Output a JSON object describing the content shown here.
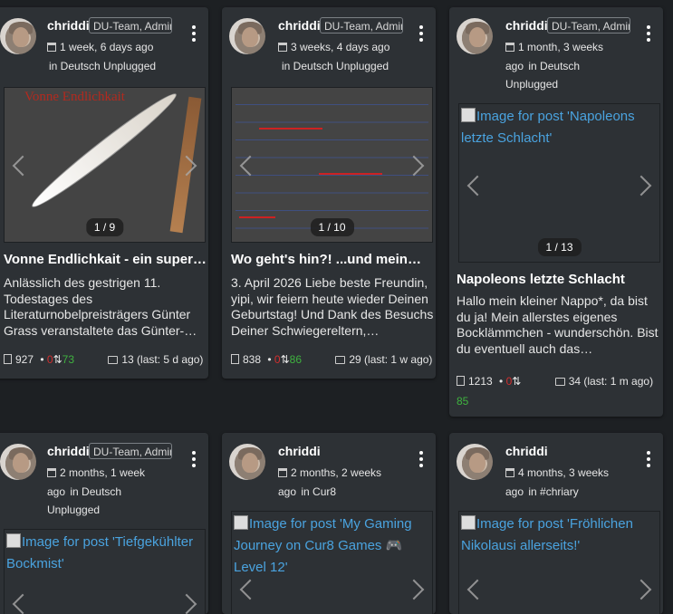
{
  "cards": [
    {
      "author": "chriddi",
      "badge": "DU-Team, Admin",
      "time": "1 week, 6 days ago",
      "community": "in Deutsch Unplugged",
      "counter": "1 / 9",
      "image_text": "Vonne Endlichkait",
      "title": "Vonne Endlichkait - ein super…",
      "excerpt": "Anlässlich des gestrigen 11. Todestages des Literaturnobelpreisträgers Günter Grass veranstaltete das Günter-…",
      "views": "927",
      "down": "0",
      "up": "73",
      "comments": "13 (last: 5 d ago)"
    },
    {
      "author": "chriddi",
      "badge": "DU-Team, Admin",
      "time": "3 weeks, 4 days ago",
      "community": "in Deutsch Unplugged",
      "counter": "1 / 10",
      "title": "Wo geht's hin?! ...und mein…",
      "excerpt": "3. April 2026 Liebe beste Freundin, yipi, wir feiern heute wieder Deinen Geburtstag! Und Dank des Besuchs Deiner Schwiegereltern,…",
      "views": "838",
      "down": "0",
      "up": "86",
      "comments": "29 (last: 1 w ago)"
    },
    {
      "author": "chriddi",
      "badge": "DU-Team, Admin",
      "time": "1 month, 3 weeks ago",
      "community": "in Deutsch Unplugged",
      "counter": "1 / 13",
      "broken_image": "Image for post 'Napoleons letzte Schlacht'",
      "title": "Napoleons letzte Schlacht",
      "excerpt": "Hallo mein kleiner Nappo*, da bist du ja! Mein allerstes eigenes Bocklämmchen - wunderschön. Bist du eventuell auch das…",
      "views": "1213",
      "down": "0",
      "up": "85",
      "comments": "34 (last: 1 m ago)"
    },
    {
      "author": "chriddi",
      "badge": "DU-Team, Admin",
      "time": "2 months, 1 week ago",
      "community": "in Deutsch Unplugged",
      "broken_image": "Image for post 'Tiefgekühlter Bockmist'"
    },
    {
      "author": "chriddi",
      "time": "2 months, 2 weeks ago",
      "community": "in Cur8",
      "broken_image": "Image for post 'My Gaming Journey on Cur8 Games 🎮 Level 12'"
    },
    {
      "author": "chriddi",
      "time": "4 months, 3 weeks ago",
      "community": "in #chriary",
      "broken_image": "Image for post 'Fröhlichen Nikolausi allerseits!'"
    }
  ]
}
